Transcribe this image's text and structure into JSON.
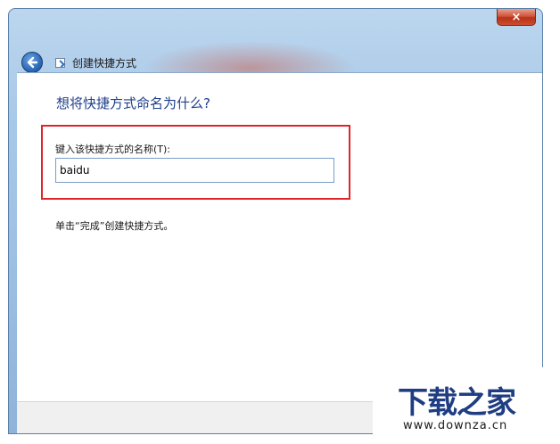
{
  "window": {
    "close_glyph": "×",
    "back_icon": "back-arrow-icon",
    "wizard_icon": "shortcut-wizard-icon",
    "wizard_title": "创建快捷方式"
  },
  "page": {
    "heading": "想将快捷方式命名为什么?",
    "field_label": "键入该快捷方式的名称(T):",
    "name_value": "baidu",
    "hint": "单击“完成”创建快捷方式。"
  },
  "watermark": {
    "logo": "下载之家",
    "url": "www.downza.cn"
  },
  "colors": {
    "heading": "#1e3f8a",
    "highlight": "#e0242a",
    "close_button": "#d0573b",
    "watermark": "#1f3d82"
  }
}
